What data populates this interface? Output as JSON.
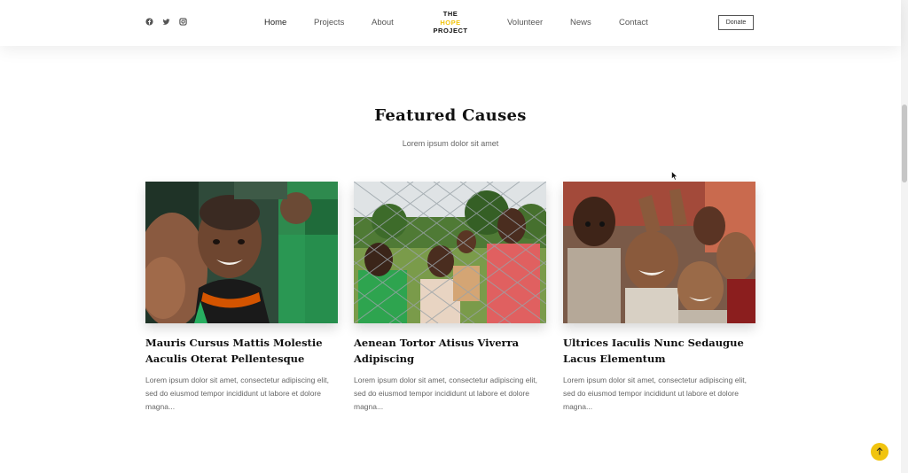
{
  "nav": {
    "social": [
      {
        "icon": "facebook-icon"
      },
      {
        "icon": "twitter-icon"
      },
      {
        "icon": "instagram-icon"
      }
    ],
    "menu": [
      "Home",
      "Projects",
      "About",
      "Volunteer",
      "News",
      "Contact"
    ],
    "logo": {
      "line1": "THE",
      "line2": "HOPE",
      "line3": "PROJECT"
    },
    "donate_label": "Donate"
  },
  "section": {
    "title": "Featured Causes",
    "subtitle": "Lorem ipsum dolor sit amet"
  },
  "cards": [
    {
      "title": "Mauris Cursus Mattis Molestie Aaculis Oterat Pellentesque",
      "text": "Lorem ipsum dolor sit amet, consectetur adipiscing elit, sed do eiusmod tempor incididunt ut labore et dolore magna...",
      "image": "photo-boy-smiling"
    },
    {
      "title": "Aenean Tortor Atisus Viverra Adipiscing",
      "text": "Lorem ipsum dolor sit amet, consectetur adipiscing elit, sed do eiusmod tempor incididunt ut labore et dolore magna...",
      "image": "photo-children-at-fence"
    },
    {
      "title": "Ultrices Iaculis Nunc Sedaugue Lacus Elementum",
      "text": "Lorem ipsum dolor sit amet, consectetur adipiscing elit, sed do eiusmod tempor incididunt ut labore et dolore magna...",
      "image": "photo-children-group-waving"
    }
  ],
  "colors": {
    "accent": "#f1c40f",
    "text": "#111111",
    "muted": "#666666"
  },
  "scroll_to_top": {
    "icon": "arrow-up-icon"
  }
}
